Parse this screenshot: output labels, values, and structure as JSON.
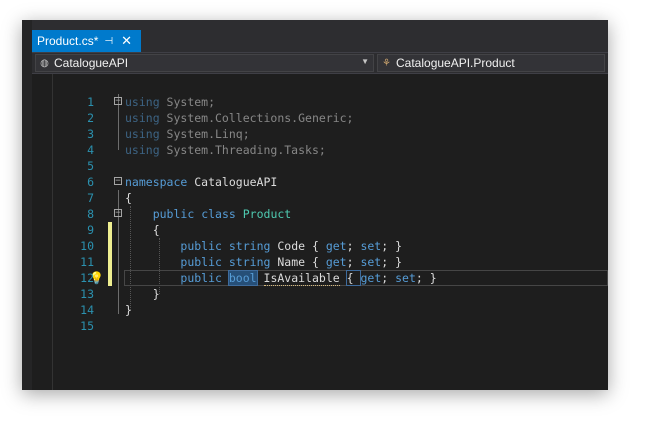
{
  "tab": {
    "title": "Product.cs*",
    "pin": "⊣",
    "close": "✕"
  },
  "nav": {
    "left": "CatalogueAPI",
    "right": "CatalogueAPI.Product",
    "left_icon": "namespace-icon",
    "right_icon": "class-icon"
  },
  "colors": {
    "accent": "#007acc",
    "keyword": "#569cd6",
    "type": "#4ec9b0",
    "lineNumber": "#2b91af",
    "change": "#efef91"
  },
  "lines": [
    {
      "n": "1"
    },
    {
      "n": "2"
    },
    {
      "n": "3"
    },
    {
      "n": "4"
    },
    {
      "n": "5"
    },
    {
      "n": "6"
    },
    {
      "n": "7"
    },
    {
      "n": "8"
    },
    {
      "n": "9"
    },
    {
      "n": "10"
    },
    {
      "n": "11"
    },
    {
      "n": "12"
    },
    {
      "n": "13"
    },
    {
      "n": "14"
    },
    {
      "n": "15"
    }
  ],
  "code": {
    "l1": {
      "kw": "using",
      "rest": " System;"
    },
    "l2": {
      "kw": "using",
      "rest": " System.Collections.Generic;"
    },
    "l3": {
      "kw": "using",
      "rest": " System.Linq;"
    },
    "l4": {
      "kw": "using",
      "rest": " System.Threading.Tasks;"
    },
    "l6": {
      "kw": "namespace",
      "rest": " CatalogueAPI"
    },
    "l7": {
      "text": "{"
    },
    "l8": {
      "kw1": "public",
      "kw2": "class",
      "type": "Product"
    },
    "l9": {
      "text": "{"
    },
    "l10": {
      "kw1": "public",
      "kw2": "string",
      "rest": " Code { ",
      "get": "get",
      "mid": "; ",
      "set": "set",
      "end": "; }"
    },
    "l11": {
      "kw1": "public",
      "kw2": "string",
      "rest": " Name { ",
      "get": "get",
      "mid": "; ",
      "set": "set",
      "end": "; }"
    },
    "l12": {
      "kw1": "public",
      "kw2": "bool",
      "name": "IsAvailable",
      "open": "{ ",
      "get": "get",
      "mid": "; ",
      "set": "set",
      "end": "; }"
    },
    "l13": {
      "text": "}"
    },
    "l14": {
      "text": "}"
    }
  }
}
